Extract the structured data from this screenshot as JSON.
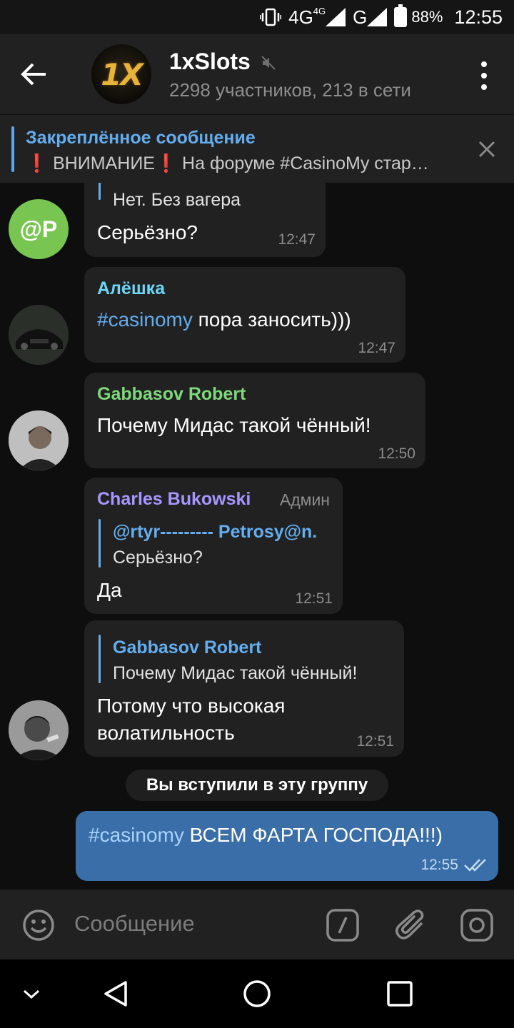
{
  "status_bar": {
    "network_4g_1": "4G",
    "network_4g_small": "4G",
    "network_g": "G",
    "battery": "88%",
    "time": "12:55"
  },
  "header": {
    "title": "1xSlots",
    "subtitle": "2298 участников, 213 в сети",
    "avatar_logo": "1X"
  },
  "pinned": {
    "label": "Закреплённое сообщение",
    "text": "❗ ВНИМАНИЕ❗  На форуме #CasinoMy стар…"
  },
  "messages": [
    {
      "reply_text": "Нет. Без вагера",
      "text": "Серьёзно?",
      "time": "12:47",
      "avatar_initials": "@P"
    },
    {
      "sender": "Алёшка",
      "hashtag": "#casinomy",
      "text": " пора заносить)))",
      "time": "12:47"
    },
    {
      "sender": "Gabbasov Robert",
      "text": "Почему Мидас такой чённый!",
      "time": "12:50"
    },
    {
      "sender": "Charles Bukowski",
      "role": "Админ",
      "reply_name": "@rtyr--------- Petrosy@n.",
      "reply_text": "Серьёзно?",
      "text": "Да",
      "time": "12:51"
    },
    {
      "reply_name": "Gabbasov Robert",
      "reply_text": "Почему Мидас такой чённый!",
      "text_line1": "Потому что высокая",
      "text_line2": "волатильность",
      "time": "12:51"
    }
  ],
  "service_message": "Вы вступили в эту группу",
  "outgoing": {
    "hashtag": "#casinomy",
    "text": " ВСЕМ ФАРТА ГОСПОДА!!!)",
    "time": "12:55"
  },
  "input": {
    "placeholder": "Сообщение"
  },
  "colors": {
    "accent": "#64aef0",
    "sender_alyoshka": "#6dd5f5",
    "sender_gabbasov": "#7ed87c",
    "sender_bukowski": "#a696ff",
    "outgoing_bubble": "#3a6ea8",
    "avatar_p": "#79c552"
  }
}
